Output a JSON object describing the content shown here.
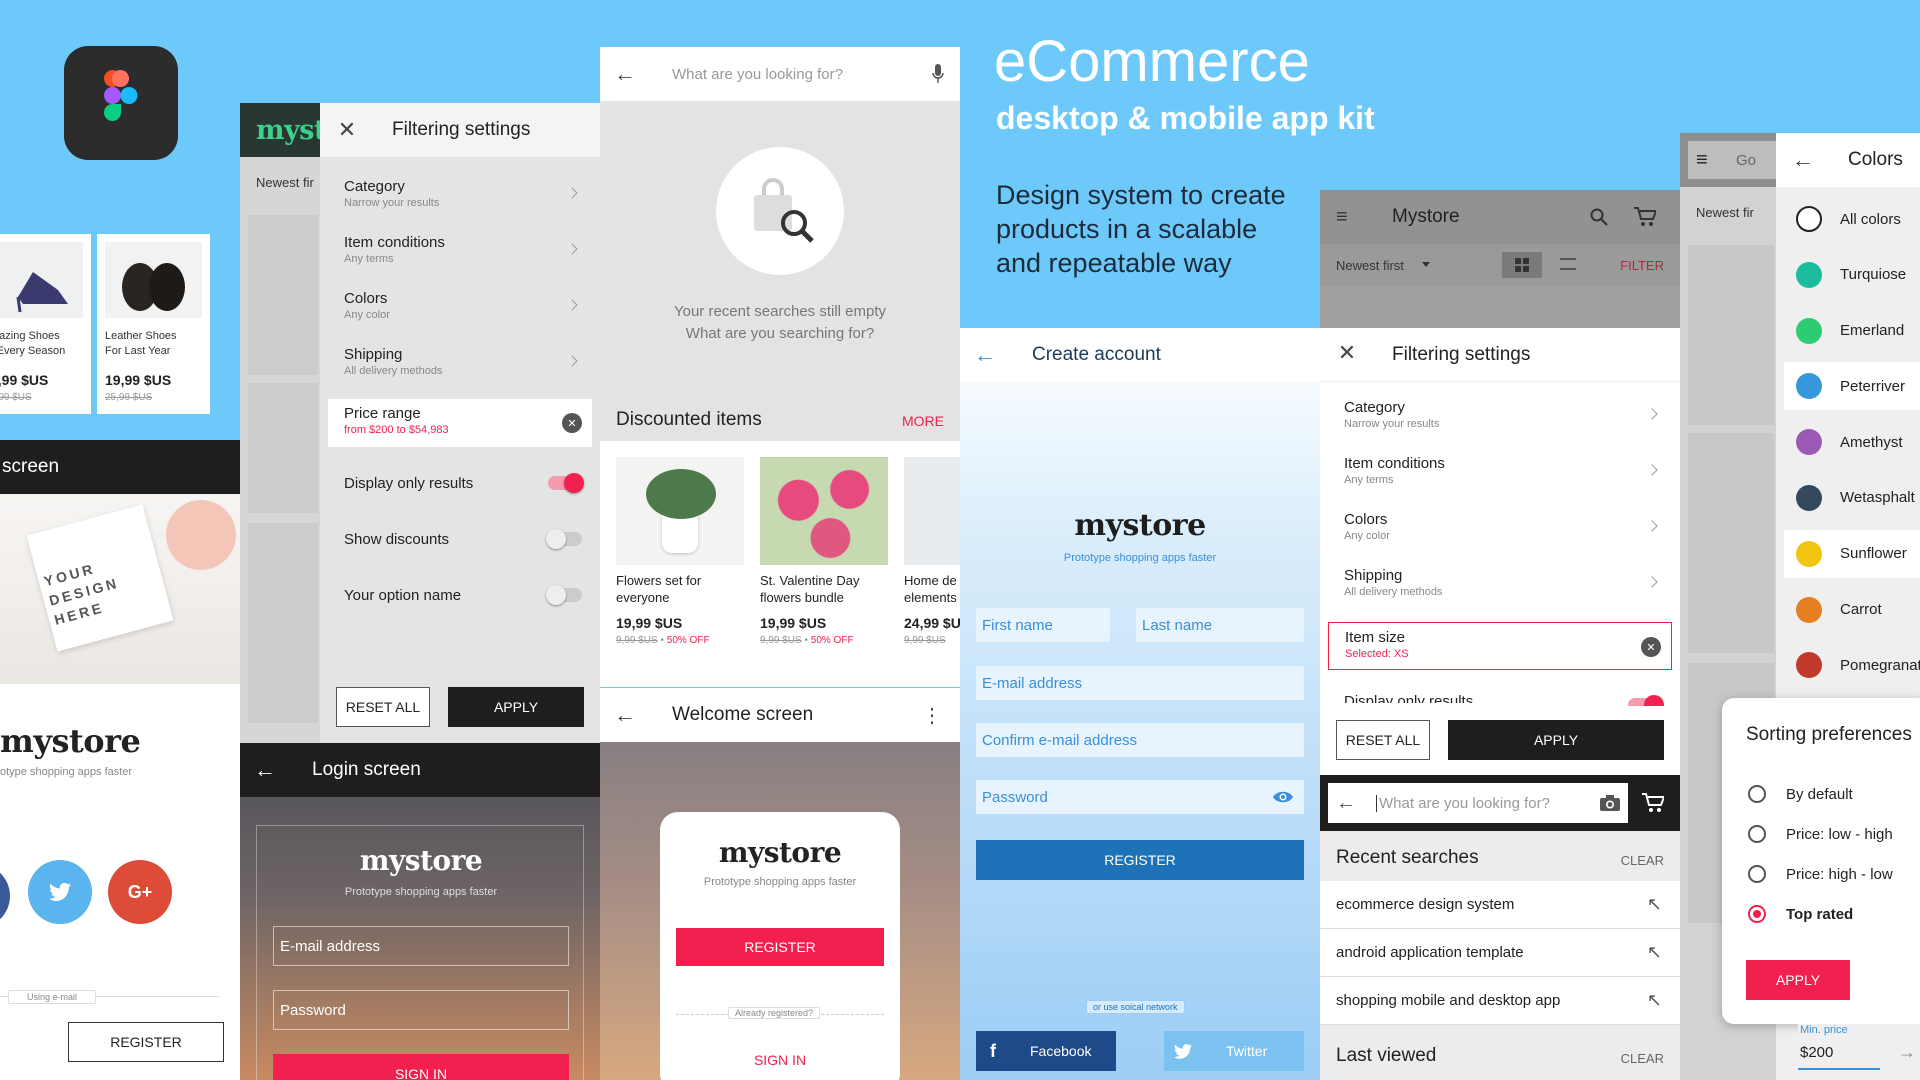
{
  "hero": {
    "title": "eCommerce",
    "subtitle": "desktop & mobile app kit",
    "tagline": "Design system to create products in a scalable and repeatable way"
  },
  "colors": {
    "accent": "#f2204e",
    "bg": "#6ec9fb",
    "dark": "#1e1e1e",
    "link": "#3a8fd8"
  },
  "p1": {
    "products": [
      {
        "name1": "mazing Shoes",
        "name2": "r Every Season",
        "price": "9,99 $US",
        "old": "9,99 $US"
      },
      {
        "name1": "Leather Shoes",
        "name2": "For Last Year",
        "price": "19,99 $US",
        "old": "25,99 $US"
      }
    ],
    "screen_label": "screen",
    "design_text": "YOUR DESIGN HERE",
    "brand": "mystore",
    "brand_tag": "otype shopping apps faster",
    "using_email": "Using e-mail",
    "register": "REGISTER"
  },
  "p2": {
    "brand_partial": "myst",
    "newest": "Newest fir",
    "title": "Filtering settings",
    "items": [
      {
        "t": "Category",
        "s": "Narrow your results"
      },
      {
        "t": "Item conditions",
        "s": "Any terms"
      },
      {
        "t": "Colors",
        "s": "Any color"
      },
      {
        "t": "Shipping",
        "s": "All delivery methods"
      }
    ],
    "price_range": {
      "t": "Price range",
      "s": "from $200 to $54,983"
    },
    "toggles": [
      {
        "t": "Display only results",
        "on": true
      },
      {
        "t": "Show discounts",
        "on": false
      },
      {
        "t": "Your option name",
        "on": false
      }
    ],
    "reset": "RESET ALL",
    "apply": "APPLY"
  },
  "p3": {
    "title": "Login screen",
    "brand": "mystore",
    "tag": "Prototype shopping apps faster",
    "email": "E-mail address",
    "password": "Password",
    "signin": "SIGN IN"
  },
  "p4": {
    "search_placeholder": "What are you looking for?",
    "empty1": "Your recent searches still empty",
    "empty2": "What are you searching for?",
    "discounted": "Discounted items",
    "more": "MORE",
    "items": [
      {
        "n1": "Flowers set for",
        "n2": "everyone",
        "price": "19,99 $US",
        "old": "9,99 $US",
        "off": "50% OFF"
      },
      {
        "n1": "St. Valentine Day",
        "n2": "flowers bundle",
        "price": "19,99 $US",
        "old": "9,99 $US",
        "off": "50% OFF"
      },
      {
        "n1": "Home de",
        "n2": "elements",
        "price": "24,99 $U",
        "old": "9,99 $US",
        "off": ""
      }
    ]
  },
  "p5": {
    "title": "Welcome screen",
    "brand": "mystore",
    "tag": "Prototype shopping apps faster",
    "register": "REGISTER",
    "already": "Already registered?",
    "signin": "SIGN IN"
  },
  "p6": {
    "title": "Create account",
    "brand": "mystore",
    "tag": "Prototype shopping apps faster",
    "first": "First name",
    "last": "Last name",
    "email": "E-mail address",
    "confirm": "Confirm e-mail address",
    "password": "Password",
    "register": "REGISTER",
    "social_note": "or use soical network",
    "facebook": "Facebook",
    "twitter": "Twitter"
  },
  "p7": {
    "app": "Mystore",
    "newest": "Newest first",
    "filter": "FILTER",
    "title": "Filtering settings",
    "items": [
      {
        "t": "Category",
        "s": "Narrow your results"
      },
      {
        "t": "Item conditions",
        "s": "Any terms"
      },
      {
        "t": "Colors",
        "s": "Any color"
      },
      {
        "t": "Shipping",
        "s": "All delivery methods"
      }
    ],
    "size": {
      "t": "Item size",
      "s": "Selected: XS"
    },
    "display_only": "Display only results",
    "reset": "RESET ALL",
    "apply": "APPLY"
  },
  "p8": {
    "placeholder": "What are you looking for?",
    "recent": "Recent searches",
    "clear": "CLEAR",
    "searches": [
      "ecommerce design system",
      "android application template",
      "shopping mobile and desktop app"
    ],
    "last_viewed": "Last viewed",
    "clear2": "CLEAR"
  },
  "p9": {
    "go": "Go",
    "newest": "Newest fir",
    "title": "Colors",
    "list": [
      {
        "name": "All colors",
        "color": "#ffffff"
      },
      {
        "name": "Turquiose",
        "color": "#1abc9c"
      },
      {
        "name": "Emerland",
        "color": "#2ecc71"
      },
      {
        "name": "Peterriver",
        "color": "#3498db"
      },
      {
        "name": "Amethyst",
        "color": "#9b59b6"
      },
      {
        "name": "Wetasphalt",
        "color": "#34495e"
      },
      {
        "name": "Sunflower",
        "color": "#f1c40f"
      },
      {
        "name": "Carrot",
        "color": "#e67e22"
      },
      {
        "name": "Pomegranat",
        "color": "#c0392b"
      }
    ]
  },
  "p10": {
    "title": "Sorting preferences",
    "options": [
      {
        "label": "By default",
        "selected": false
      },
      {
        "label": "Price: low - high",
        "selected": false
      },
      {
        "label": "Price: high - low",
        "selected": false
      },
      {
        "label": "Top rated",
        "selected": true
      }
    ],
    "apply": "APPLY",
    "min_label": "Min. price",
    "min_value": "$200"
  }
}
